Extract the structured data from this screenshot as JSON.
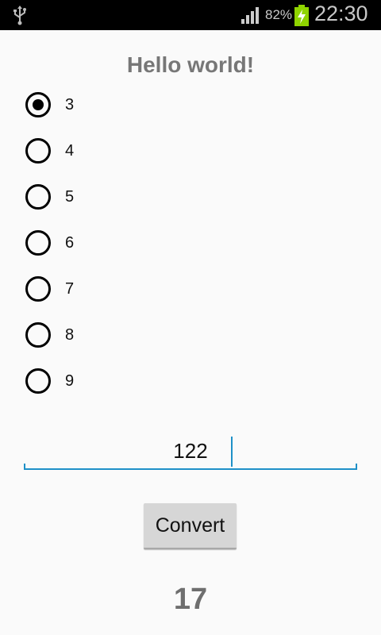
{
  "status_bar": {
    "battery_percent": "82%",
    "time": "22:30",
    "icons": [
      "usb-icon",
      "signal-icon",
      "battery-charging-icon"
    ]
  },
  "main": {
    "title": "Hello world!",
    "radio_options": [
      {
        "label": "3",
        "selected": true
      },
      {
        "label": "4",
        "selected": false
      },
      {
        "label": "5",
        "selected": false
      },
      {
        "label": "6",
        "selected": false
      },
      {
        "label": "7",
        "selected": false
      },
      {
        "label": "8",
        "selected": false
      },
      {
        "label": "9",
        "selected": false
      }
    ],
    "input_value": "122",
    "convert_label": "Convert",
    "result": "17"
  },
  "colors": {
    "accent": "#1e90c8",
    "background": "#fafafa",
    "title": "#777777",
    "battery": "#8fd400"
  }
}
